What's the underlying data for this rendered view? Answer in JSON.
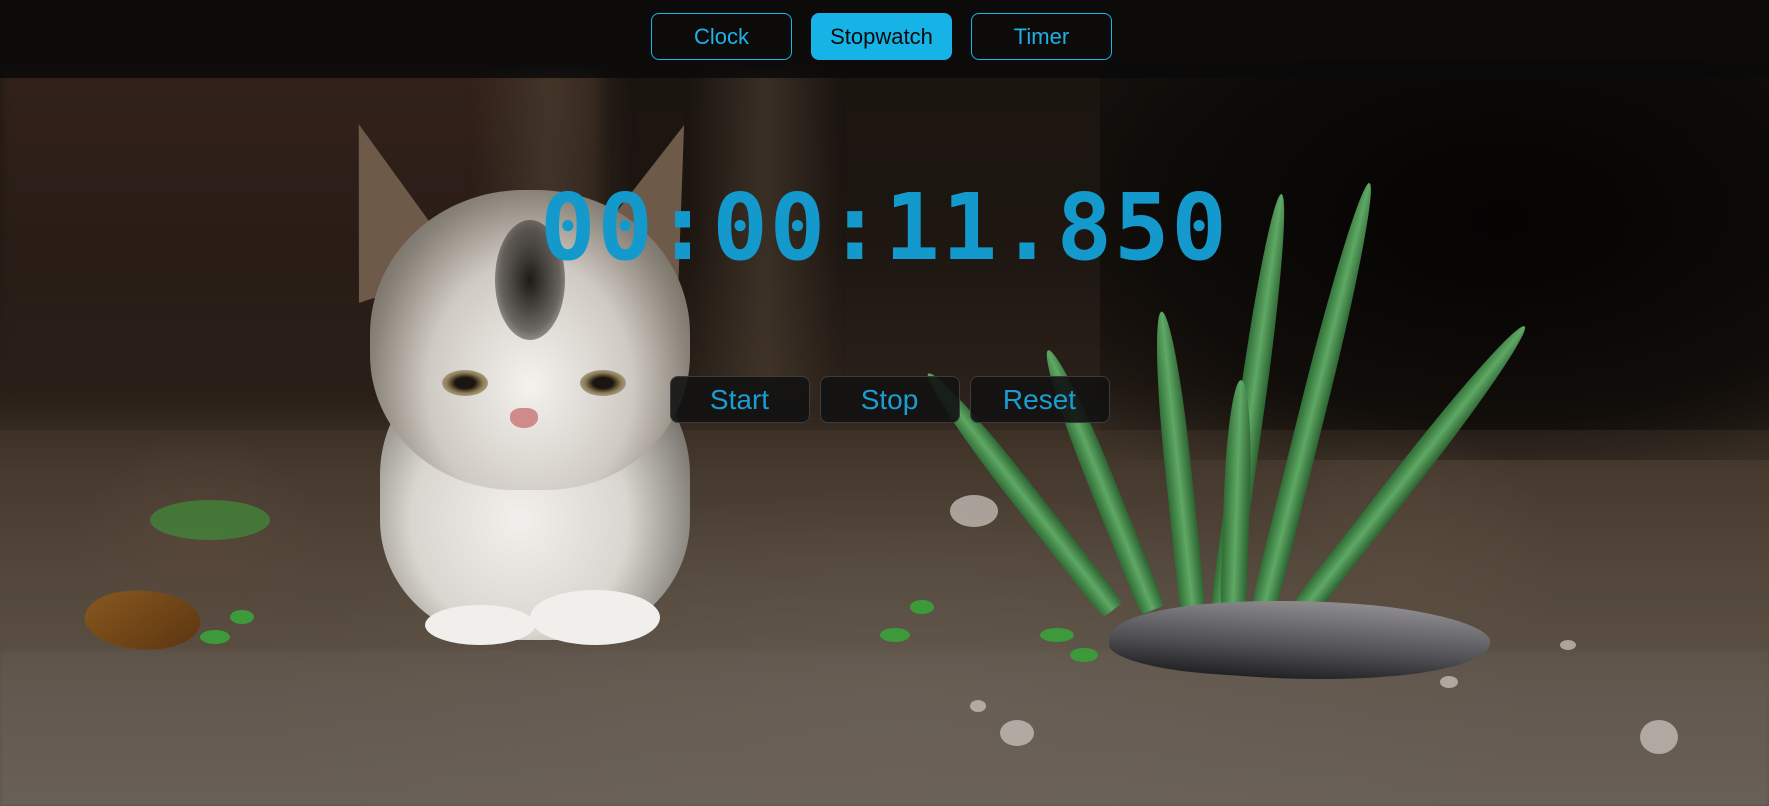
{
  "mode_tabs": [
    {
      "label": "Clock",
      "active": false
    },
    {
      "label": "Stopwatch",
      "active": true
    },
    {
      "label": "Timer",
      "active": false
    }
  ],
  "stopwatch": {
    "time": "00:00:11.850"
  },
  "controls": {
    "start_label": "Start",
    "stop_label": "Stop",
    "reset_label": "Reset"
  },
  "colors": {
    "accent": "#15b3e6",
    "time_text": "#1499cc",
    "topbar": "#0a0a0a"
  },
  "background": {
    "subject": "kitten-photo"
  }
}
